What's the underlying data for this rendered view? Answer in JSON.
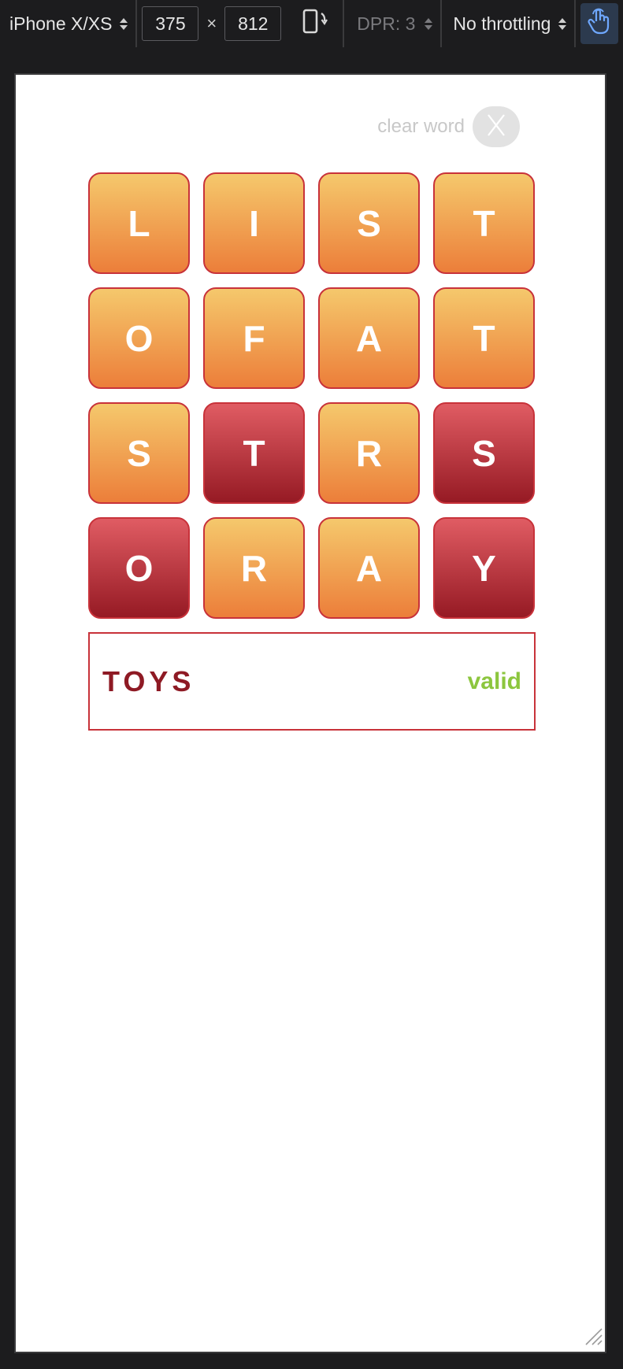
{
  "toolbar": {
    "device": "iPhone X/XS",
    "width": "375",
    "times": "×",
    "height": "812",
    "dpr": "DPR: 3",
    "throttling": "No throttling",
    "icons": [
      "rotate-icon",
      "touch-icon"
    ]
  },
  "game": {
    "clear_label": "clear word",
    "clear_button": "X",
    "tiles": [
      {
        "letter": "L",
        "selected": false
      },
      {
        "letter": "I",
        "selected": false
      },
      {
        "letter": "S",
        "selected": false
      },
      {
        "letter": "T",
        "selected": false
      },
      {
        "letter": "O",
        "selected": false
      },
      {
        "letter": "F",
        "selected": false
      },
      {
        "letter": "A",
        "selected": false
      },
      {
        "letter": "T",
        "selected": false
      },
      {
        "letter": "S",
        "selected": false
      },
      {
        "letter": "T",
        "selected": true
      },
      {
        "letter": "R",
        "selected": false
      },
      {
        "letter": "S",
        "selected": true
      },
      {
        "letter": "O",
        "selected": true
      },
      {
        "letter": "R",
        "selected": false
      },
      {
        "letter": "A",
        "selected": false
      },
      {
        "letter": "Y",
        "selected": true
      }
    ],
    "current_word": "TOYS",
    "status": "valid",
    "colors": {
      "tile_top": "#f5c86c",
      "tile_bottom": "#ec7e3a",
      "selected_top": "#e05c63",
      "selected_bottom": "#961a24",
      "border": "#c8323a",
      "word": "#8e1a24",
      "valid": "#8cc63e"
    }
  }
}
